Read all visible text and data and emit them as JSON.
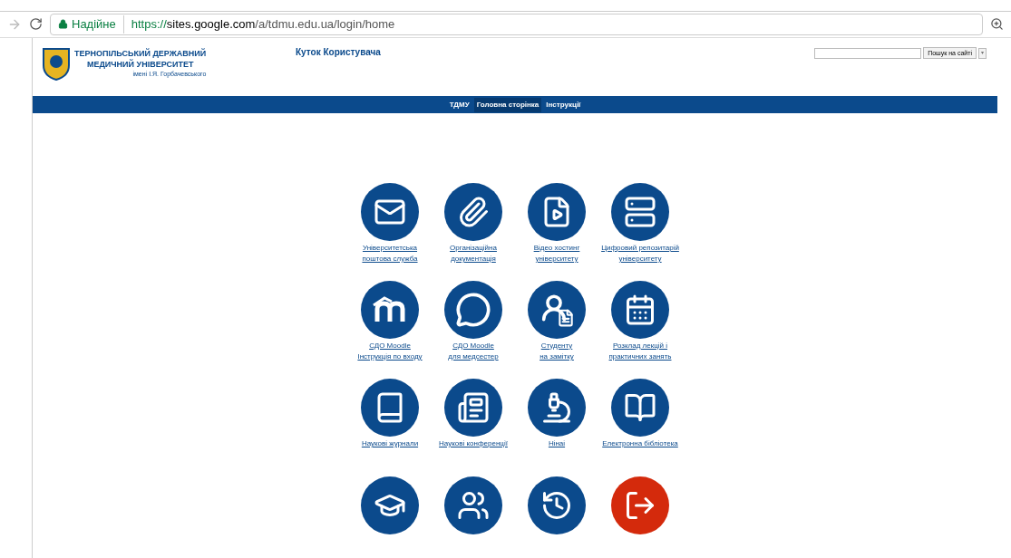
{
  "browser": {
    "back_disabled": true,
    "secure_label": "Надійне",
    "url_scheme": "https://",
    "url_host": "sites.google.com",
    "url_path": "/a/tdmu.edu.ua/login/home"
  },
  "header": {
    "logo_lines": [
      "ТЕРНОПІЛЬСЬКИЙ ДЕРЖАВНИЙ",
      "МЕДИЧНИЙ УНІВЕРСИТЕТ"
    ],
    "logo_subtitle": "імені І.Я. Горбачевського",
    "page_title": "Куток Користувача",
    "search_button": "Пошук на сайті",
    "search_menu": "▾"
  },
  "nav": [
    {
      "label": "ТДМУ",
      "selected": false
    },
    {
      "label": "Головна сторінка",
      "selected": true
    },
    {
      "label": "Інструкції",
      "selected": false
    }
  ],
  "tiles": [
    {
      "kind": "mail",
      "color": "#0b4a8c",
      "lines": [
        "Університетська",
        "поштова служба"
      ]
    },
    {
      "kind": "paperclip",
      "color": "#0b4a8c",
      "lines": [
        "Організаційна",
        "документація"
      ]
    },
    {
      "kind": "video",
      "color": "#0b4a8c",
      "lines": [
        "Відео хостинг",
        "університету"
      ]
    },
    {
      "kind": "server",
      "color": "#0b4a8c",
      "lines": [
        "Цифровий репозитарій",
        "університету"
      ]
    },
    {
      "kind": "moodle",
      "color": "#0b4a8c",
      "lines": [
        "СДО Moodle",
        "Інструкція по входу"
      ]
    },
    {
      "kind": "moodle-chat",
      "color": "#0b4a8c",
      "lines": [
        "СДО Moodle",
        "для медсестер"
      ]
    },
    {
      "kind": "student",
      "color": "#0b4a8c",
      "lines": [
        "Студенту",
        "на замітку"
      ]
    },
    {
      "kind": "calendar",
      "color": "#0b4a8c",
      "lines": [
        "Розклад лекцій і",
        "практичних занять"
      ]
    },
    {
      "kind": "book",
      "color": "#0b4a8c",
      "lines": [
        "Наукові журнали"
      ]
    },
    {
      "kind": "newspaper",
      "color": "#0b4a8c",
      "lines": [
        "Наукові конференції"
      ]
    },
    {
      "kind": "microscope",
      "color": "#0b4a8c",
      "lines": [
        "Нінаі"
      ]
    },
    {
      "kind": "library",
      "color": "#0b4a8c",
      "lines": [
        "Електронна бібліотека"
      ]
    },
    {
      "kind": "graduation",
      "color": "#0b4a8c"
    },
    {
      "kind": "users",
      "color": "#0b4a8c"
    },
    {
      "kind": "history",
      "color": "#0b4a8c"
    },
    {
      "kind": "exit",
      "color": "#d42a0c"
    }
  ]
}
